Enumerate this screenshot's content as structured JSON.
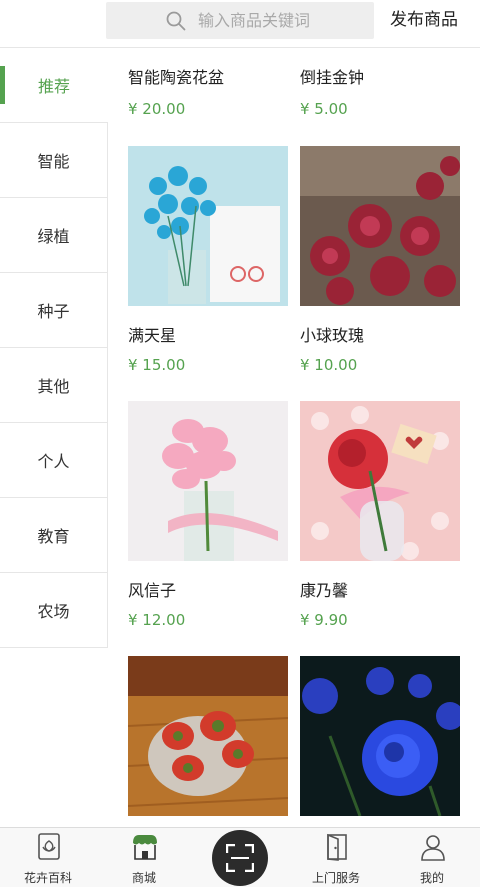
{
  "header": {
    "search_placeholder": "输入商品关键词",
    "search_icon": "search-icon",
    "publish_label": "发布商品"
  },
  "sidebar": {
    "items": [
      {
        "label": "推荐",
        "active": true
      },
      {
        "label": "智能"
      },
      {
        "label": "绿植"
      },
      {
        "label": "种子"
      },
      {
        "label": "其他"
      },
      {
        "label": "个人"
      },
      {
        "label": "教育"
      },
      {
        "label": "农场"
      }
    ]
  },
  "products": [
    {
      "name": "智能陶瓷花盆",
      "price": "¥ 20.00"
    },
    {
      "name": "倒挂金钟",
      "price": "¥ 5.00"
    },
    {
      "name": "满天星",
      "price": "¥ 15.00"
    },
    {
      "name": "小球玫瑰",
      "price": "¥ 10.00"
    },
    {
      "name": "风信子",
      "price": "¥ 12.00"
    },
    {
      "name": "康乃馨",
      "price": "¥ 9.90"
    }
  ],
  "bottom_nav": {
    "tabs": [
      {
        "label": "花卉百科",
        "icon": "flower-book-icon"
      },
      {
        "label": "商城",
        "icon": "shop-awning-icon"
      },
      {
        "label": "",
        "icon": "scan-icon"
      },
      {
        "label": "上门服务",
        "icon": "door-icon"
      },
      {
        "label": "我的",
        "icon": "user-icon"
      }
    ]
  },
  "colors": {
    "accent": "#55a24f",
    "text": "#222222",
    "placeholder": "#a9a9a9",
    "divider": "#e6e6e6"
  }
}
